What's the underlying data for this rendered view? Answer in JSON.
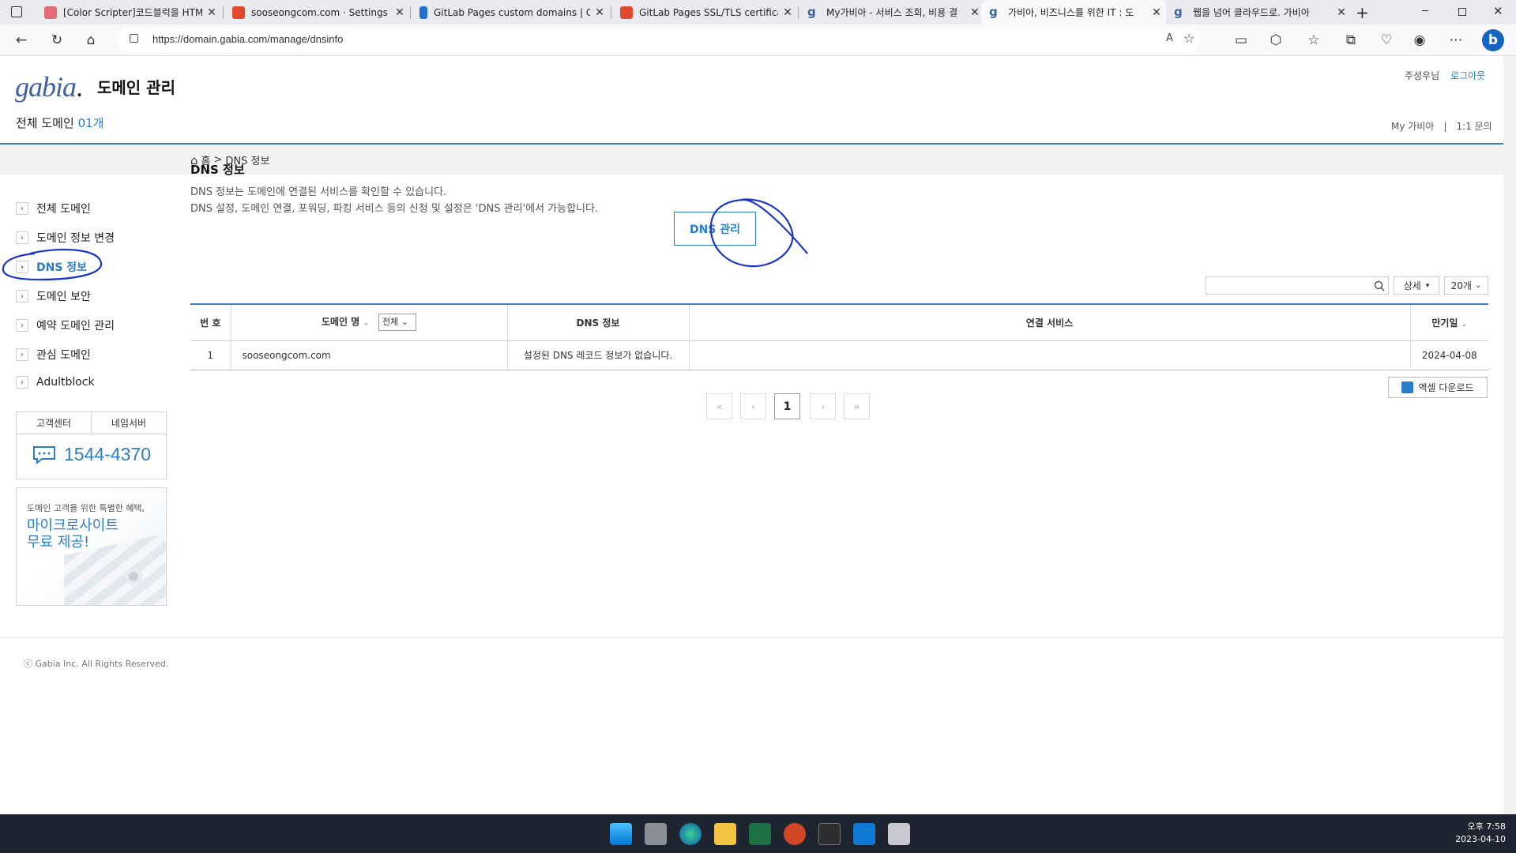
{
  "browser": {
    "tabs": [
      {
        "title": "[Color Scripter]코드블럭을 HTML",
        "favicon_color": "#e06c75"
      },
      {
        "title": "sooseongcom.com · Settings · 도",
        "favicon_color": "#e2492f"
      },
      {
        "title": "GitLab Pages custom domains | G",
        "favicon_color": "#1f6fd0"
      },
      {
        "title": "GitLab Pages SSL/TLS certificate",
        "favicon_color": "#e2492f"
      },
      {
        "title": "My가비아 - 서비스 조회, 비용 결",
        "favicon_color": "#3b62a3"
      },
      {
        "title": "가비아, 비즈니스를 위한 IT : 도",
        "favicon_color": "#3b62a3"
      },
      {
        "title": "웹을 넘어 클라우드로. 가비아",
        "favicon_color": "#3b62a3"
      }
    ],
    "active_tab": 5,
    "url": "https://domain.gabia.com/manage/dnsinfo"
  },
  "header": {
    "logo": "gabia",
    "logo_dot": ".",
    "service_title": "도메인 관리",
    "total_label": "전체 도메인",
    "total_count": "01개",
    "user_name": "주성우님",
    "logout": "로그아웃",
    "my_gabia": "My 가비아",
    "separator": "|",
    "inquiry": "1:1 문의"
  },
  "breadcrumb": {
    "home": "홈",
    "sep": ">",
    "current": "DNS 정보"
  },
  "sidebar": {
    "items": [
      {
        "label": "전체 도메인"
      },
      {
        "label": "도메인 정보 변경"
      },
      {
        "label": "DNS 정보",
        "selected": true
      },
      {
        "label": "도메인 보안"
      },
      {
        "label": "예약 도메인 관리"
      },
      {
        "label": "관심 도메인"
      },
      {
        "label": "Adultblock"
      }
    ],
    "support_tabs": [
      "고객센터",
      "네임서버"
    ],
    "phone": "1544-4370",
    "banner_small": "도메인 고객을 위한 특별한 혜택,",
    "banner_line1": "마이크로사이트",
    "banner_line2": "무료 제공!"
  },
  "content": {
    "title": "DNS 정보",
    "desc1": "DNS 정보는 도메인에 연결된 서비스를 확인할 수 있습니다.",
    "desc2": "DNS 설정, 도메인 연결, 포워딩, 파킹 서비스 등의 신청 및 설정은 'DNS 관리'에서 가능합니다.",
    "dns_manage_button": "DNS 관리",
    "search_placeholder": "",
    "detail_label": "상세",
    "per_page": "20개"
  },
  "table": {
    "headers": {
      "no": "번 호",
      "domain": "도메인 명",
      "filter": "전체",
      "dns": "DNS 정보",
      "service": "연결 서비스",
      "expiry": "만기일"
    },
    "rows": [
      {
        "no": "1",
        "domain": "sooseongcom.com",
        "dns": "설정된 DNS 레코드 정보가 없습니다.",
        "service": "",
        "expiry": "2024-04-08"
      }
    ]
  },
  "pagination": {
    "current": "1"
  },
  "excel_button": "엑셀 다운로드",
  "footer": "ⓒ Gabia Inc. All Rights Reserved.",
  "taskbar": {
    "time": "오후 7:58",
    "date": "2023-04-10"
  },
  "colors": {
    "accent": "#2a7ec9",
    "annotation": "#1a35c8"
  }
}
